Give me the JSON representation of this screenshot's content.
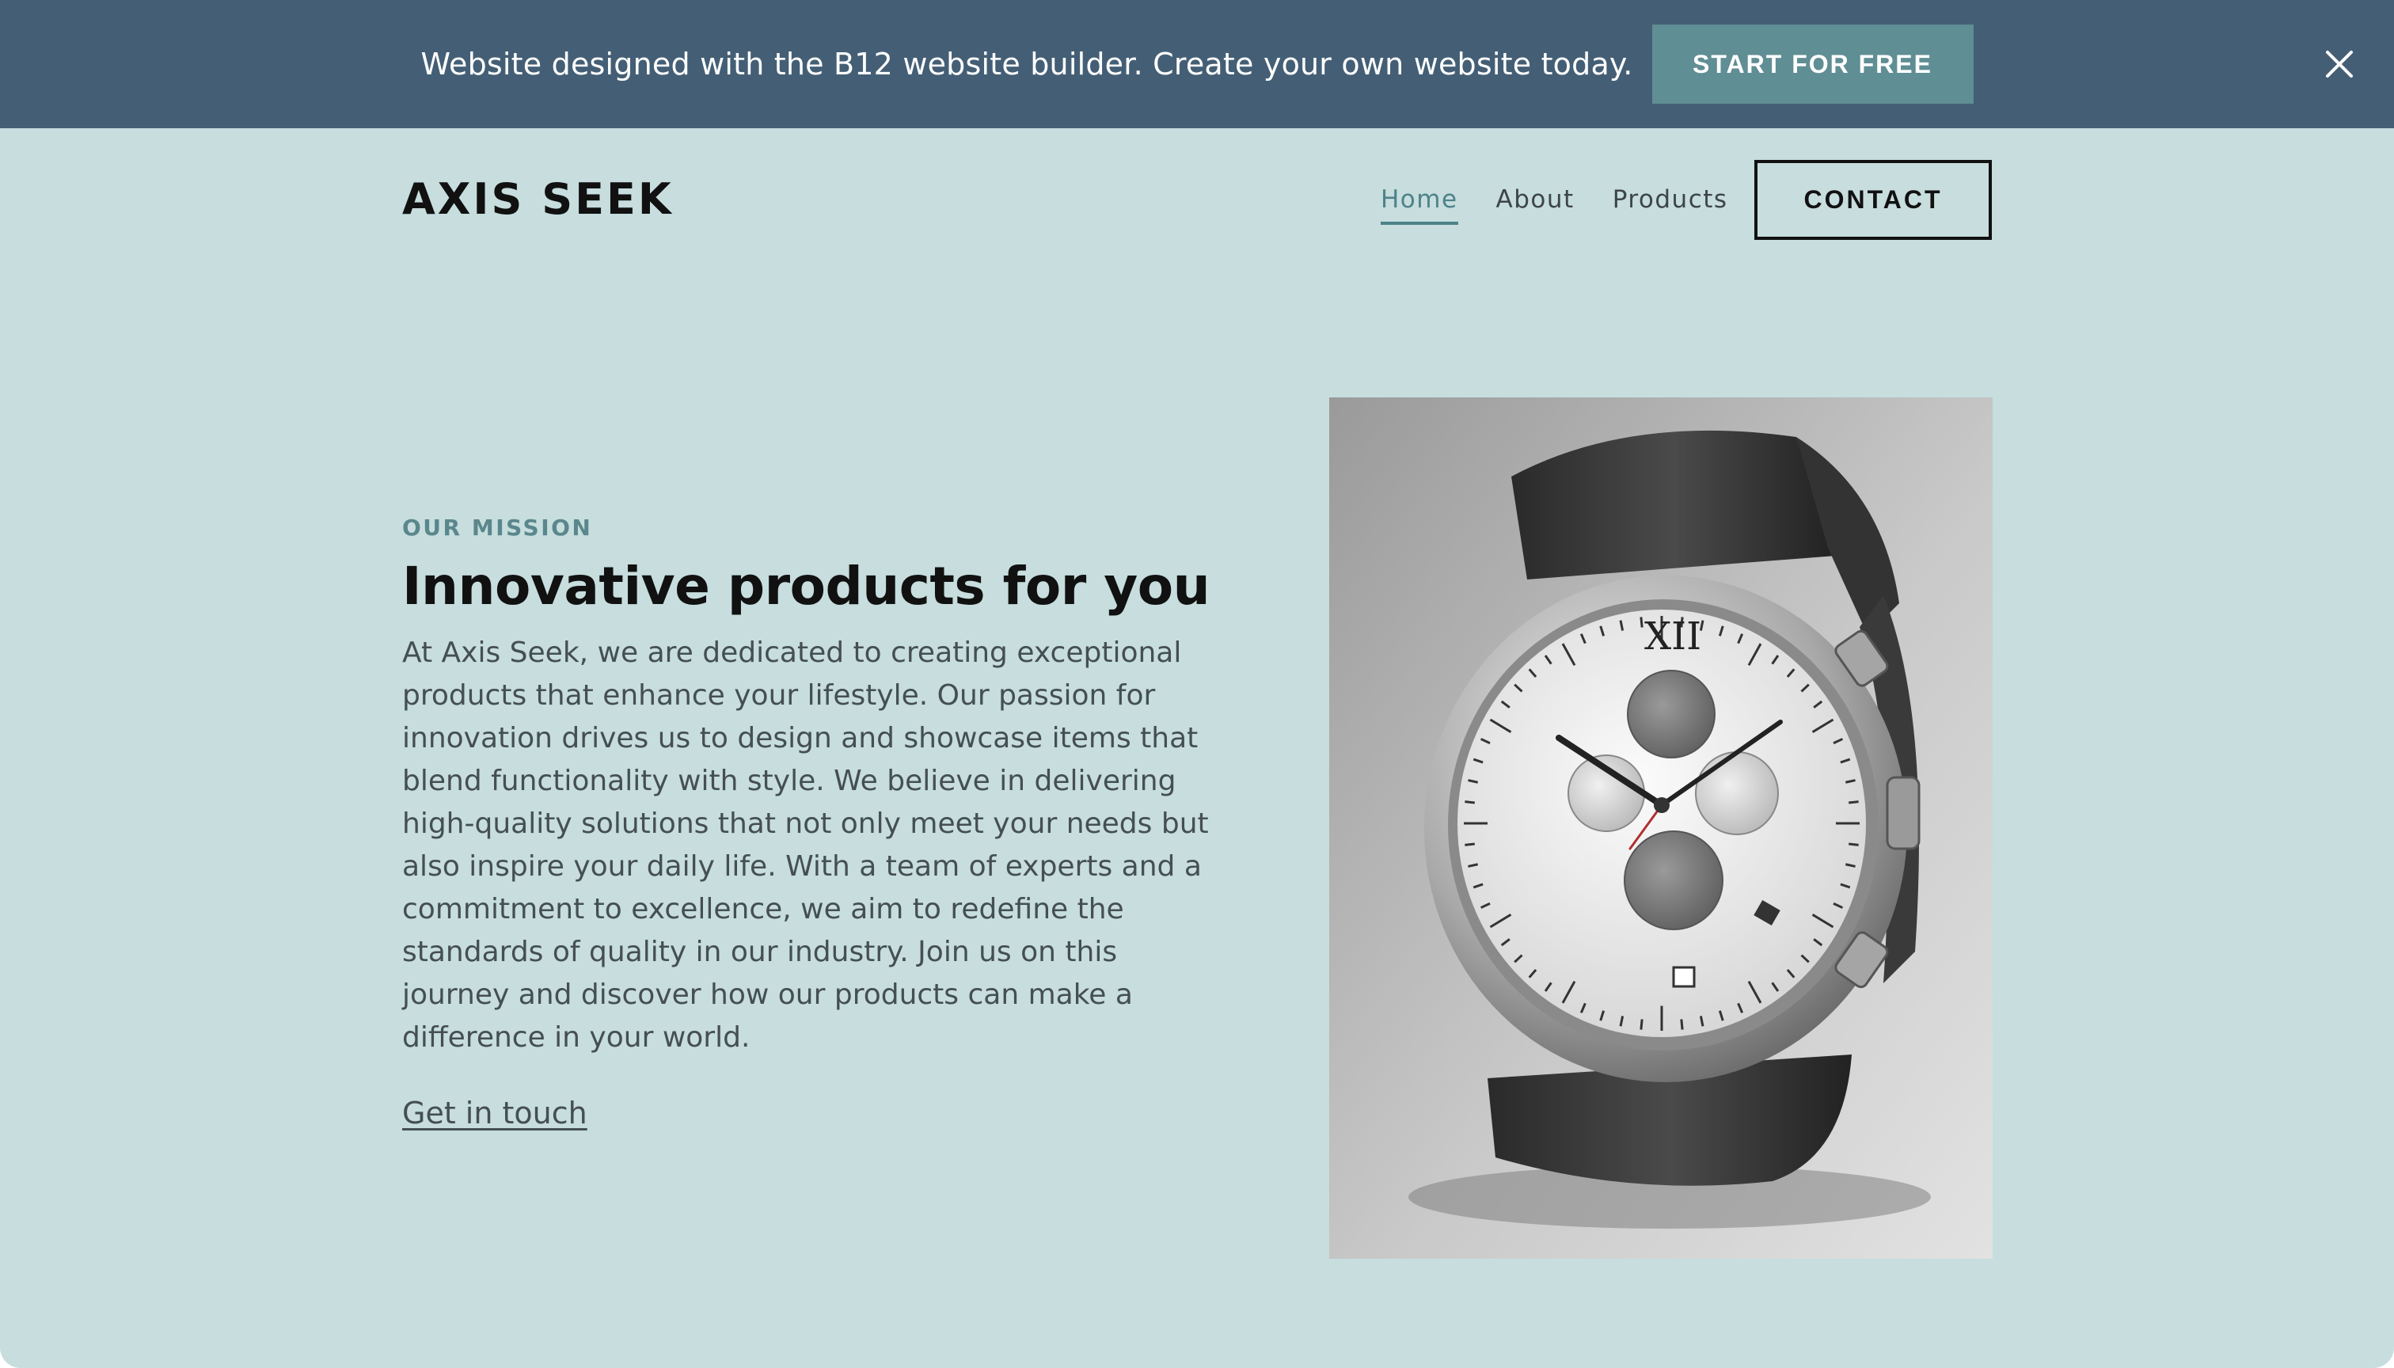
{
  "banner": {
    "text": "Website designed with the B12 website builder. Create your own website today.",
    "cta_label": "START FOR FREE",
    "close_icon": "close-icon"
  },
  "header": {
    "logo": "AXIS SEEK",
    "nav": [
      {
        "label": "Home",
        "active": true
      },
      {
        "label": "About",
        "active": false
      },
      {
        "label": "Products",
        "active": false
      }
    ],
    "contact_label": "CONTACT"
  },
  "hero": {
    "eyebrow": "OUR MISSION",
    "title": "Innovative products for you",
    "body": "At Axis Seek, we are dedicated to creating exceptional products that enhance your lifestyle. Our passion for innovation drives us to design and showcase items that blend functionality with style. We believe in delivering high-quality solutions that not only meet your needs but also inspire your daily life. With a team of experts and a commitment to excellence, we aim to redefine the standards of quality in our industry. Join us on this journey and discover how our products can make a difference in your world.",
    "link_label": "Get in touch",
    "image_subject": "chronograph-watch-image",
    "watch_numeral": "XII"
  },
  "colors": {
    "banner_bg": "#445f75",
    "cta_bg": "#5f8e94",
    "page_bg": "#c7ddde",
    "accent": "#4e8289"
  }
}
